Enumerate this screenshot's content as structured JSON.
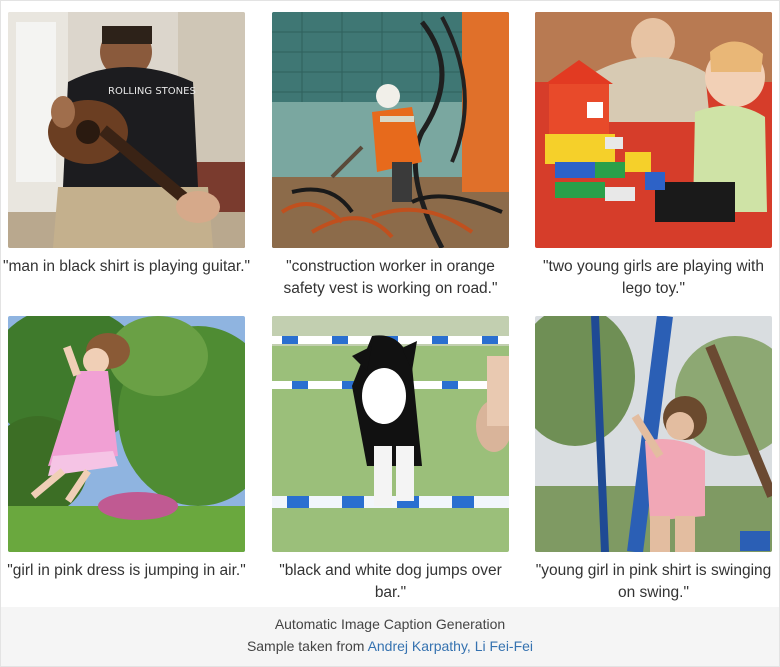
{
  "captions": [
    "\"man in black shirt is playing guitar.\"",
    "\"construction worker in orange safety vest is working on road.\"",
    "\"two young girls are playing with lego toy.\"",
    "\"girl in pink dress is jumping in air.\"",
    "\"black and white dog jumps over bar.\"",
    "\"young girl in pink shirt is swinging on swing.\""
  ],
  "photos": [
    "photo: man playing acoustic guitar",
    "photo: construction worker in orange vest",
    "photo: child playing with lego house",
    "photo: girl in pink dress jumping",
    "photo: black and white dog jumping over bar",
    "photo: girl on playground pole"
  ],
  "footer": {
    "title": "Automatic Image Caption Generation",
    "source_prefix": "Sample taken from ",
    "source_link": "Andrej Karpathy, Li Fei-Fei"
  },
  "colors": {
    "link": "#3572b0",
    "caption_text": "#333333",
    "footer_bg": "#f5f5f5"
  }
}
